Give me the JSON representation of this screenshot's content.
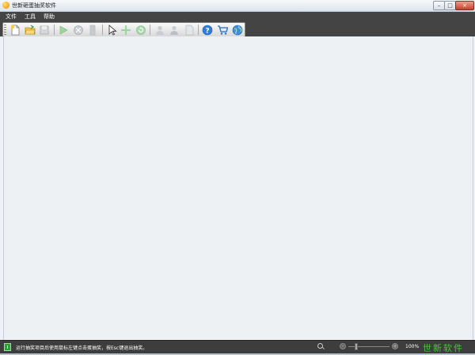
{
  "window": {
    "title": "世新砸蛋抽奖软件",
    "controls": {
      "minimize": "–",
      "maximize": "□",
      "close": "×"
    }
  },
  "menu": {
    "items": [
      {
        "label": "文件"
      },
      {
        "label": "工具"
      },
      {
        "label": "帮助"
      }
    ]
  },
  "toolbar": {
    "buttons": [
      {
        "icon": "new-document-icon",
        "enabled": true
      },
      {
        "icon": "open-folder-icon",
        "enabled": true
      },
      {
        "icon": "save-icon",
        "enabled": false
      },
      {
        "icon": "play-icon",
        "enabled": false
      },
      {
        "icon": "tools-icon",
        "enabled": false
      },
      {
        "icon": "list-icon",
        "enabled": false
      },
      {
        "icon": "cursor-icon",
        "enabled": true
      },
      {
        "icon": "move-icon",
        "enabled": false
      },
      {
        "icon": "refresh-icon",
        "enabled": false
      },
      {
        "icon": "user-icon",
        "enabled": false
      },
      {
        "icon": "user-alt-icon",
        "enabled": false
      },
      {
        "icon": "page-icon",
        "enabled": false
      },
      {
        "icon": "help-icon",
        "enabled": true
      },
      {
        "icon": "cart-icon",
        "enabled": true
      },
      {
        "icon": "globe-icon",
        "enabled": true
      }
    ]
  },
  "status": {
    "message": "运行抽奖项目后使用鼠标左键点击蛋抽奖，按Esc键退出抽奖。",
    "zoom_level": "100%",
    "zoom_fraction": 0.2,
    "brand": "世新软件"
  },
  "colors": {
    "menubar": "#444444",
    "statusbar": "#3d3d3d",
    "brand_green": "#3ecf2b",
    "content_bg": "#eef1f4"
  }
}
